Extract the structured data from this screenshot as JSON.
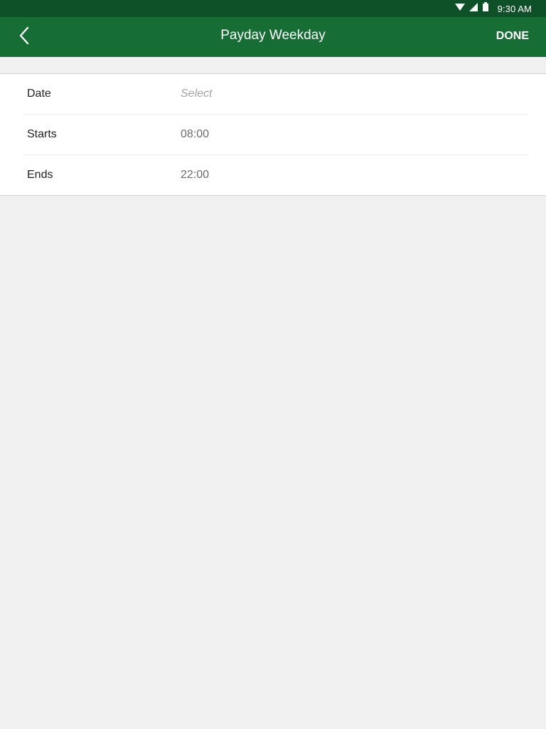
{
  "status_bar": {
    "time": "9:30 AM",
    "icons": [
      "wifi-icon",
      "signal-icon",
      "battery-icon"
    ]
  },
  "app_bar": {
    "title": "Payday Weekday",
    "done_label": "DONE",
    "back_icon": "chevron-left-icon"
  },
  "form": {
    "rows": [
      {
        "label": "Date",
        "value": "Select"
      },
      {
        "label": "Starts",
        "value": "08:00"
      },
      {
        "label": "Ends",
        "value": "22:00"
      }
    ]
  },
  "colors": {
    "status_bar": "#0e5129",
    "app_bar": "#166e35",
    "background": "#f0f0f0",
    "placeholder": "#a4a4a4"
  }
}
